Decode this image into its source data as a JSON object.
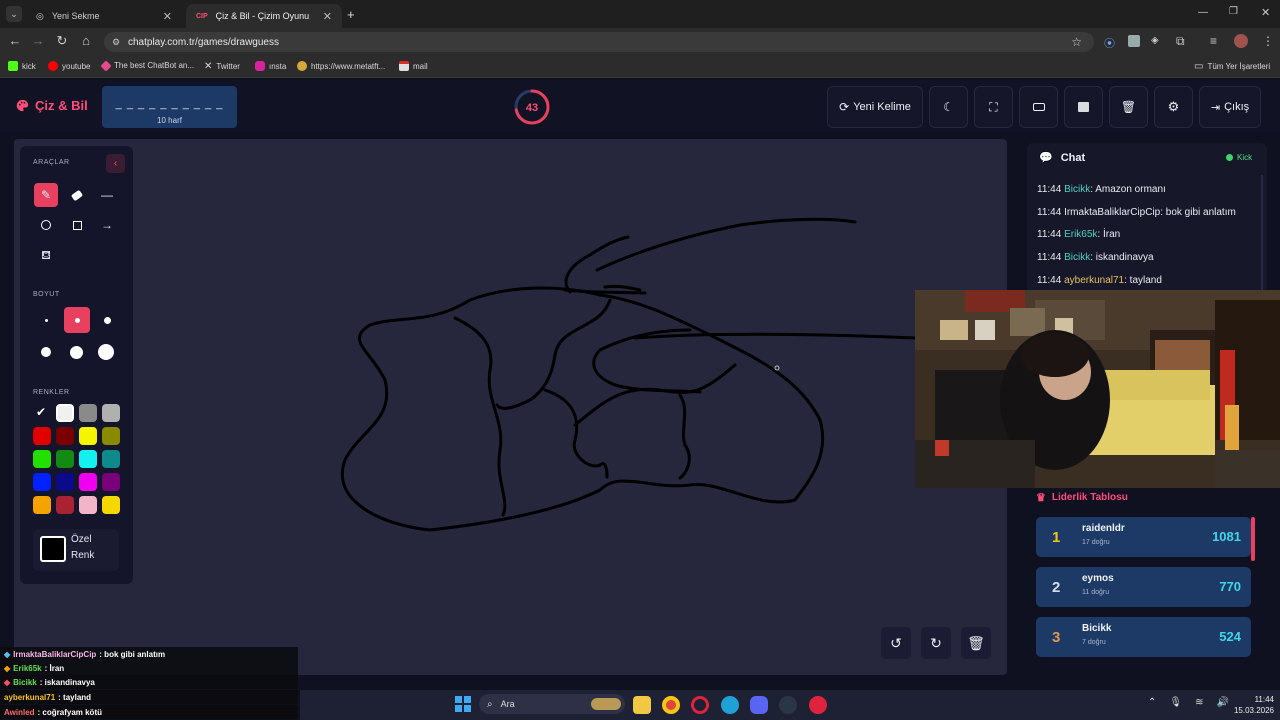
{
  "browser": {
    "tabs": [
      {
        "title": "Yeni Sekme"
      },
      {
        "title": "Çiz & Bil - Çizim Oyunu"
      }
    ],
    "url": "chatplay.com.tr/games/drawguess",
    "bookmarks": [
      "kick",
      "youtube",
      "The best ChatBot an...",
      "Twitter",
      "ınsta",
      "https://www.metatft...",
      "mail"
    ],
    "all_bookmarks": "Tüm Yer İşaretleri"
  },
  "header": {
    "logo": "Çiz & Bil",
    "word_dashes": "_ _ _ _ _ _ _ _ _ _",
    "word_length": "10 harf",
    "timer": "43",
    "timer_fraction": 0.72,
    "new_word": "Yeni Kelime",
    "exit": "Çıkış"
  },
  "tools": {
    "section_tools": "ARAÇLAR",
    "section_size": "BOYUT",
    "section_colors": "RENKLER",
    "custom_color_line1": "Özel",
    "custom_color_line2": "Renk",
    "colors": [
      "#ffffff",
      "#f0f0f0",
      "#8a8a8a",
      "#b0b0b0",
      "#e00000",
      "#7a0000",
      "#f5f500",
      "#8a8a00",
      "#22e000",
      "#138a13",
      "#12f0f0",
      "#0f8a8a",
      "#0022ff",
      "#0a0a8a",
      "#f000f0",
      "#7a007a",
      "#f5a300",
      "#a82231",
      "#f2b4c8",
      "#f5d800"
    ]
  },
  "chat": {
    "title": "Chat",
    "source": "Kick",
    "messages": [
      {
        "time": "11:44",
        "user": "Bicikk",
        "text": ": Amazon ormanı"
      },
      {
        "time": "11:44",
        "user": "IrmaktaBaliklarCipCip",
        "text": ": bok gibi anlatım"
      },
      {
        "time": "11:44",
        "user": "Erik65k",
        "text": ": İran"
      },
      {
        "time": "11:44",
        "user": "Bicikk",
        "text": ": iskandinavya"
      },
      {
        "time": "11:44",
        "user": "ayberkunal71",
        "text": ": tayland"
      }
    ]
  },
  "leaderboard": {
    "title": "Liderlik Tablosu",
    "rows": [
      {
        "rank": "1",
        "name": "raidenldr",
        "sub": "17 doğru",
        "score": "1081"
      },
      {
        "rank": "2",
        "name": "eymos",
        "sub": "11 doğru",
        "score": "770"
      },
      {
        "rank": "3",
        "name": "Bicikk",
        "sub": "7 doğru",
        "score": "524"
      }
    ]
  },
  "overlay_chat": [
    {
      "user": "IrmaktaBaliklarCipCip",
      "text": ": bok gibi anlatım"
    },
    {
      "user": "Erik65k",
      "text": ": İran"
    },
    {
      "user": "Bicikk",
      "text": ": iskandinavya"
    },
    {
      "user": "ayberkunal71",
      "text": ": tayland"
    },
    {
      "user": "Awinled",
      "text": ": coğrafyam kötü"
    }
  ],
  "taskbar": {
    "search": "Ara",
    "time": "11:44",
    "date": "15.03.2026"
  }
}
